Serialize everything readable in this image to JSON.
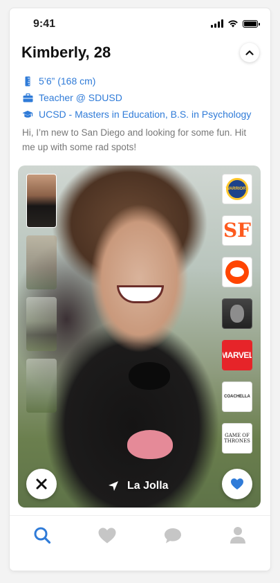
{
  "status_bar": {
    "time": "9:41"
  },
  "profile": {
    "name_age": "Kimberly, 28",
    "height": "5’6” (168 cm)",
    "job": "Teacher @ SDUSD",
    "education": "UCSD - Masters in Education, B.S. in Psychology",
    "bio": "Hi, I’m new to San Diego and looking for some fun. Hit me up with some rad spots!"
  },
  "photo": {
    "location": "La Jolla",
    "thumbnails": [
      "photo-1",
      "photo-2",
      "photo-3",
      "photo-4"
    ],
    "active_thumbnail": 0
  },
  "interests": [
    {
      "name": "Golden State Warriors",
      "label": "WARRIORS"
    },
    {
      "name": "San Francisco Giants",
      "label": "SF"
    },
    {
      "name": "Reddit",
      "label": ""
    },
    {
      "name": "Eminem",
      "label": ""
    },
    {
      "name": "Marvel",
      "label": "MARVEL"
    },
    {
      "name": "Coachella",
      "label": "COACHELLA"
    },
    {
      "name": "Game of Thrones",
      "label": "GAME OF THRONES"
    }
  ],
  "tabs": [
    {
      "name": "search",
      "active": true
    },
    {
      "name": "likes",
      "active": false
    },
    {
      "name": "messages",
      "active": false
    },
    {
      "name": "profile",
      "active": false
    }
  ],
  "colors": {
    "accent": "#2f7bd8",
    "inactive_tab": "#c6c6c6",
    "like": "#2f7bd8"
  }
}
